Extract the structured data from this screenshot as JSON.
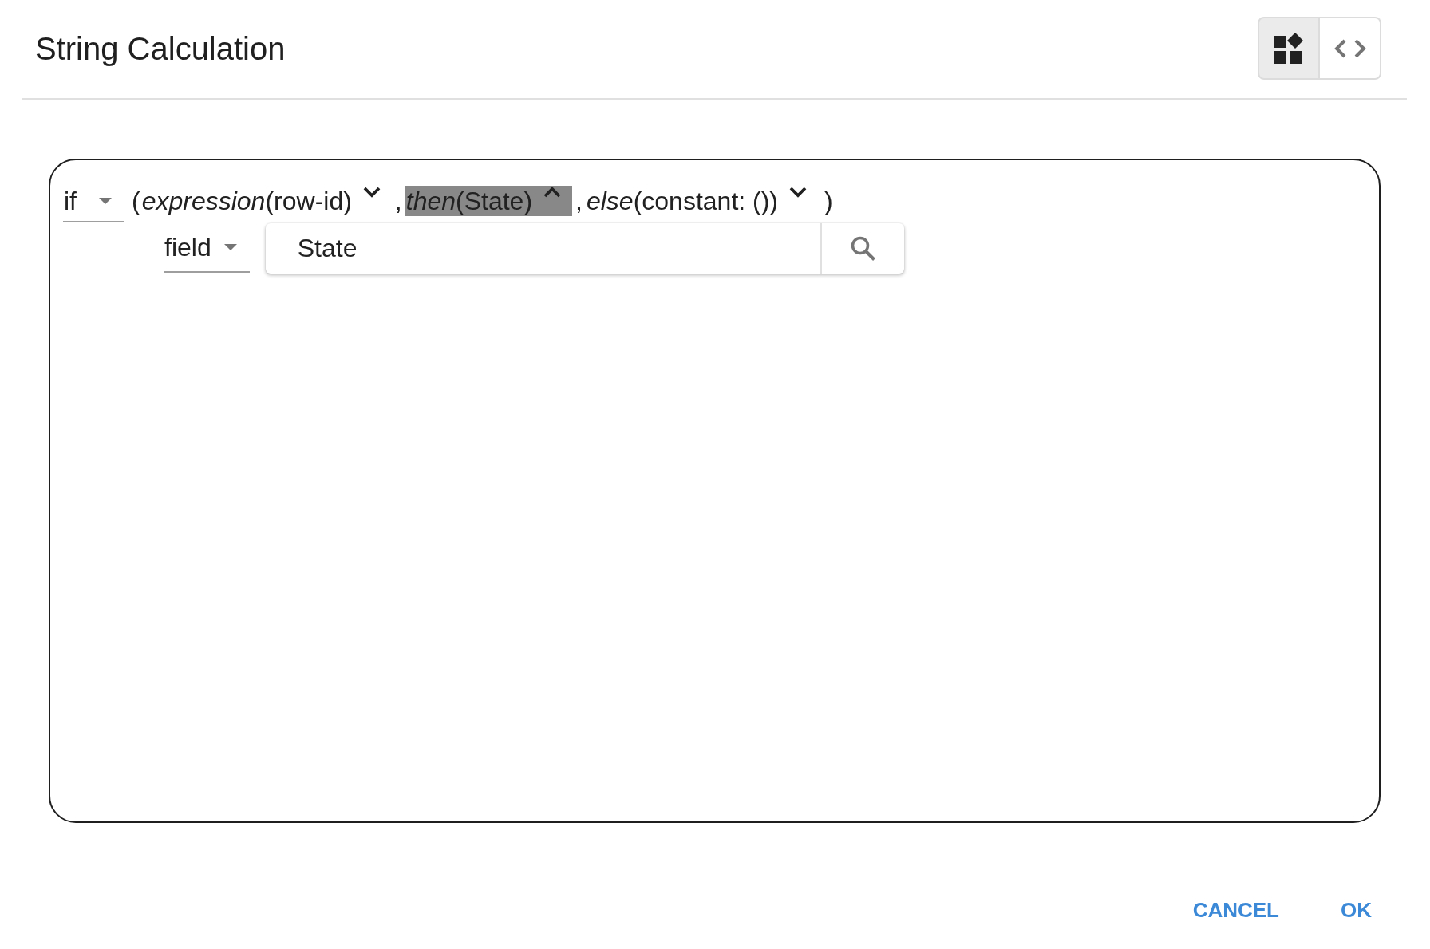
{
  "dialog": {
    "title": "String Calculation"
  },
  "view_modes": [
    {
      "kind": "blocks",
      "selected": true
    },
    {
      "kind": "code",
      "selected": false
    }
  ],
  "expression": {
    "operator": "if",
    "arguments": [
      {
        "prefix": "(",
        "label": "*expression*(row-id)",
        "expanded": false,
        "selected": false
      },
      {
        "prefix": ",",
        "label": "*then*(State)",
        "expanded": true,
        "selected": true,
        "editor": {
          "source": "field",
          "search_value": "State"
        }
      },
      {
        "prefix": ",",
        "label": "*else*(constant: ())",
        "expanded": false,
        "selected": false
      }
    ],
    "suffix": ")"
  },
  "buttons": [
    {
      "label": "CANCEL"
    },
    {
      "label": "OK"
    }
  ]
}
